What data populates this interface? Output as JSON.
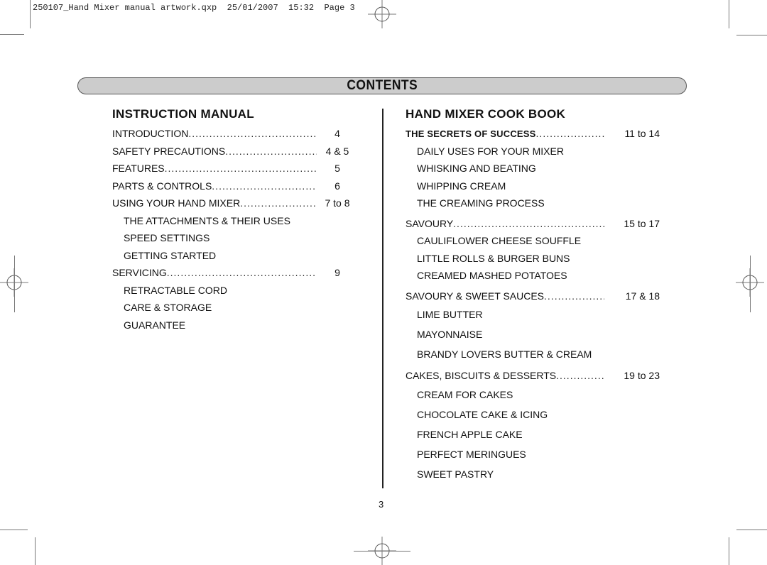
{
  "slug_line": "250107_Hand Mixer manual artwork.qxp  25/01/2007  15:32  Page 3",
  "banner": {
    "title": "CONTENTS"
  },
  "instruction_manual": {
    "title": "INSTRUCTION MANUAL",
    "entries": [
      {
        "label": "INTRODUCTION",
        "page": "4",
        "subs": []
      },
      {
        "label": "SAFETY PRECAUTIONS",
        "page": "4 & 5",
        "subs": []
      },
      {
        "label": "FEATURES",
        "page": "5",
        "subs": []
      },
      {
        "label": "PARTS & CONTROLS",
        "page": "6",
        "subs": []
      },
      {
        "label": "USING YOUR HAND MIXER",
        "page": "7 to 8",
        "subs": [
          "THE ATTACHMENTS & THEIR USES",
          "SPEED SETTINGS",
          "GETTING STARTED"
        ]
      },
      {
        "label": "SERVICING",
        "page": "9",
        "subs": [
          "RETRACTABLE CORD",
          "CARE & STORAGE",
          "GUARANTEE"
        ]
      }
    ]
  },
  "cook_book": {
    "title": "HAND MIXER COOK BOOK",
    "entries": [
      {
        "label": "THE SECRETS OF SUCCESS",
        "page": "11 to 14",
        "subs": [
          "DAILY USES FOR YOUR MIXER",
          "WHISKING AND BEATING",
          "WHIPPING CREAM",
          "THE CREAMING PROCESS"
        ]
      },
      {
        "label": "SAVOURY",
        "page": "15 to 17",
        "subs": [
          "CAULIFLOWER CHEESE SOUFFLE",
          "LITTLE ROLLS & BURGER BUNS",
          "CREAMED MASHED POTATOES"
        ]
      },
      {
        "label": "SAVOURY & SWEET SAUCES",
        "page": "17 & 18",
        "subs": [
          "LIME BUTTER",
          "MAYONNAISE",
          "BRANDY LOVERS BUTTER & CREAM"
        ]
      },
      {
        "label": "CAKES, BISCUITS & DESSERTS",
        "page": "19 to 23",
        "subs": [
          "CREAM FOR CAKES",
          "CHOCOLATE CAKE & ICING",
          "FRENCH APPLE CAKE",
          "PERFECT MERINGUES",
          "SWEET PASTRY"
        ]
      }
    ]
  },
  "footer": {
    "page_number": "3"
  }
}
